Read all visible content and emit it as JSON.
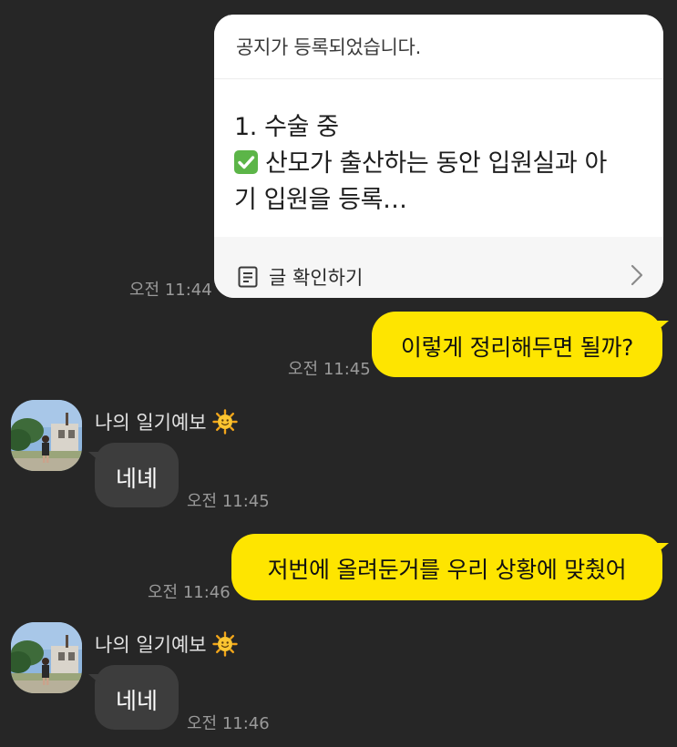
{
  "notice": {
    "header": "공지가 등록되었습니다.",
    "body_line1": "1. 수술 중",
    "body_line2": "산모가 출산하는 동안 입원실과 아",
    "body_line3": "기 입원을 등록…",
    "footer_label": "글 확인하기",
    "timestamp": "오전 11:44",
    "check_icon": "check-box-icon",
    "doc_icon": "document-icon",
    "chevron_icon": "chevron-right-icon"
  },
  "messages": [
    {
      "sender": "me",
      "text": "이렇게 정리해두면 될까?",
      "timestamp": "오전 11:45"
    },
    {
      "sender": "other",
      "name": "나의 일기예보",
      "text": "네녜",
      "timestamp": "오전 11:45"
    },
    {
      "sender": "me",
      "text": "저번에 올려둔거를 우리 상황에 맞췄어",
      "timestamp": "오전 11:46"
    },
    {
      "sender": "other",
      "name": "나의 일기예보",
      "text": "네네",
      "timestamp": "오전 11:46"
    }
  ],
  "colors": {
    "background": "#262626",
    "my_bubble": "#fee500",
    "other_bubble": "#3d3d3d",
    "timestamp": "#9a9a9a",
    "card": "#ffffff"
  }
}
